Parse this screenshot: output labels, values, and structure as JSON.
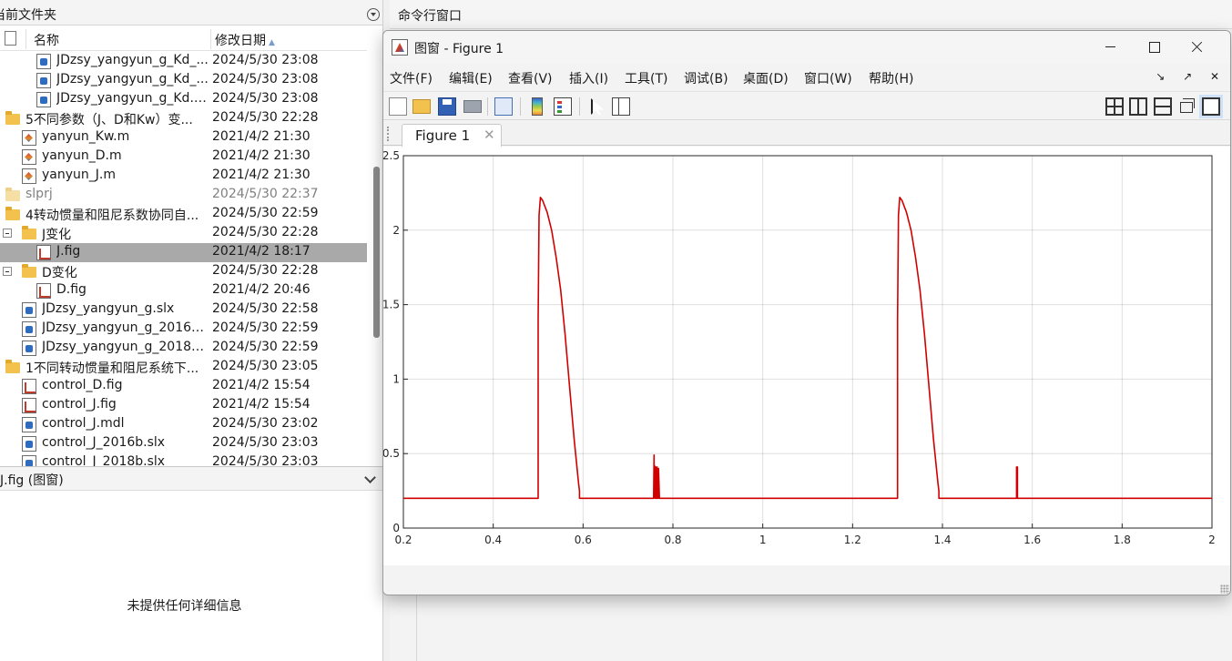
{
  "left_panel": {
    "title": "当前文件夹",
    "col_name": "名称",
    "col_date": "修改日期",
    "sort_arrow": "▲",
    "rows": [
      {
        "indent": 40,
        "icon": "slx",
        "name": "JDzsy_yangyun_g_Kd_...",
        "date": "2024/5/30 23:08"
      },
      {
        "indent": 40,
        "icon": "slx",
        "name": "JDzsy_yangyun_g_Kd_...",
        "date": "2024/5/30 23:08"
      },
      {
        "indent": 40,
        "icon": "slx",
        "name": "JDzsy_yangyun_g_Kd.slx",
        "date": "2024/5/30 23:08"
      },
      {
        "indent": 6,
        "icon": "folder",
        "name": "5不同参数（J、D和Kw）变...",
        "date": "2024/5/30 22:28"
      },
      {
        "indent": 24,
        "icon": "m",
        "name": "yanyun_Kw.m",
        "date": "2021/4/2 21:30"
      },
      {
        "indent": 24,
        "icon": "m",
        "name": "yanyun_D.m",
        "date": "2021/4/2 21:30"
      },
      {
        "indent": 24,
        "icon": "m",
        "name": "yanyun_J.m",
        "date": "2021/4/2 21:30"
      },
      {
        "indent": 6,
        "icon": "folder-light",
        "name": "slprj",
        "date": "2024/5/30 22:37",
        "dim": true
      },
      {
        "indent": 6,
        "icon": "folder",
        "name": "4转动惯量和阻尼系数协同自...",
        "date": "2024/5/30 22:59"
      },
      {
        "indent": 24,
        "icon": "folder",
        "name": "J变化",
        "date": "2024/5/30 22:28",
        "expander": true
      },
      {
        "indent": 40,
        "icon": "fig",
        "name": "J.fig",
        "date": "2021/4/2 18:17",
        "selected": true
      },
      {
        "indent": 24,
        "icon": "folder",
        "name": "D变化",
        "date": "2024/5/30 22:28",
        "expander": true
      },
      {
        "indent": 40,
        "icon": "fig",
        "name": "D.fig",
        "date": "2021/4/2 20:46"
      },
      {
        "indent": 24,
        "icon": "slx",
        "name": "JDzsy_yangyun_g.slx",
        "date": "2024/5/30 22:58"
      },
      {
        "indent": 24,
        "icon": "slx",
        "name": "JDzsy_yangyun_g_2016b...",
        "date": "2024/5/30 22:59"
      },
      {
        "indent": 24,
        "icon": "slx",
        "name": "JDzsy_yangyun_g_2018b...",
        "date": "2024/5/30 22:59"
      },
      {
        "indent": 6,
        "icon": "folder",
        "name": "1不同转动惯量和阻尼系统下...",
        "date": "2024/5/30 23:05"
      },
      {
        "indent": 24,
        "icon": "fig",
        "name": "control_D.fig",
        "date": "2021/4/2 15:54"
      },
      {
        "indent": 24,
        "icon": "fig",
        "name": "control_J.fig",
        "date": "2021/4/2 15:54"
      },
      {
        "indent": 24,
        "icon": "slx",
        "name": "control_J.mdl",
        "date": "2024/5/30 23:02"
      },
      {
        "indent": 24,
        "icon": "slx",
        "name": "control_J_2016b.slx",
        "date": "2024/5/30 23:03"
      },
      {
        "indent": 24,
        "icon": "slx",
        "name": "control_J_2018b.slx",
        "date": "2024/5/30 23:03"
      }
    ]
  },
  "detail_panel": {
    "title": "J.fig  (图窗)",
    "message": "未提供任何详细信息"
  },
  "command_window": {
    "title": "命令行窗口"
  },
  "figure_window": {
    "title": "图窗 - Figure 1",
    "menu": [
      "文件(F)",
      "编辑(E)",
      "查看(V)",
      "插入(I)",
      "工具(T)",
      "调试(B)",
      "桌面(D)",
      "窗口(W)",
      "帮助(H)"
    ],
    "menu_right": "↘ ↗ ✕",
    "tab_label": "Figure 1",
    "tab_close": "✕"
  },
  "chart_data": {
    "type": "line",
    "title": "",
    "xlabel": "",
    "ylabel": "",
    "xlim": [
      0.2,
      2
    ],
    "ylim": [
      0,
      2.5
    ],
    "xticks": [
      "0.2",
      "0.4",
      "0.6",
      "0.8",
      "1",
      "1.2",
      "1.4",
      "1.6",
      "1.8",
      "2"
    ],
    "yticks": [
      "0",
      "0.5",
      "1",
      "1.5",
      "2",
      "2.5"
    ],
    "grid": true,
    "color": "#d10000",
    "series": [
      {
        "x": [
          0.2,
          0.5,
          0.5,
          0.502,
          0.505,
          0.51,
          0.52,
          0.53,
          0.54,
          0.55,
          0.56,
          0.57,
          0.58,
          0.59,
          0.592,
          0.592,
          0.757,
          0.758,
          0.758,
          0.759,
          0.76,
          0.761,
          0.762,
          0.762,
          0.764,
          0.765,
          0.766,
          0.766,
          0.768,
          0.768,
          0.77,
          0.77,
          1.3,
          1.3,
          1.302,
          1.305,
          1.31,
          1.32,
          1.33,
          1.34,
          1.35,
          1.36,
          1.37,
          1.38,
          1.39,
          1.392,
          1.392,
          1.565,
          1.565,
          1.567,
          1.567,
          2.0
        ],
        "y": [
          0.2,
          0.2,
          1.4,
          2.1,
          2.22,
          2.2,
          2.12,
          2.0,
          1.82,
          1.6,
          1.3,
          0.95,
          0.6,
          0.3,
          0.25,
          0.2,
          0.2,
          0.49,
          0.25,
          0.42,
          0.2,
          0.41,
          0.2,
          0.41,
          0.2,
          0.41,
          0.2,
          0.4,
          0.2,
          0.4,
          0.2,
          0.2,
          0.2,
          1.4,
          2.1,
          2.22,
          2.2,
          2.12,
          2.0,
          1.82,
          1.6,
          1.3,
          0.95,
          0.6,
          0.3,
          0.25,
          0.2,
          0.2,
          0.41,
          0.41,
          0.2,
          0.2
        ]
      }
    ]
  }
}
